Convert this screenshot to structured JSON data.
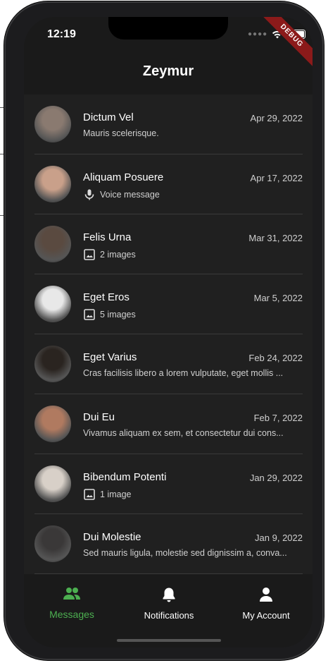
{
  "status": {
    "time": "12:19",
    "debug_banner": "DEBUG"
  },
  "appbar": {
    "title": "Zeymur"
  },
  "conversations": [
    {
      "name": "Dictum Vel",
      "date": "Apr 29, 2022",
      "preview": "Mauris scelerisque.",
      "type": "text",
      "avatar_color": "#8a7a70"
    },
    {
      "name": "Aliquam Posuere",
      "date": "Apr 17, 2022",
      "preview": "Voice message",
      "type": "voice",
      "avatar_color": "#c9a08a"
    },
    {
      "name": "Felis Urna",
      "date": "Mar 31, 2022",
      "preview": "2 images",
      "type": "image",
      "avatar_color": "#5a4a40"
    },
    {
      "name": "Eget Eros",
      "date": "Mar 5, 2022",
      "preview": "5 images",
      "type": "image",
      "avatar_color": "#e8e8e8"
    },
    {
      "name": "Eget Varius",
      "date": "Feb 24, 2022",
      "preview": "Cras facilisis libero a lorem vulputate, eget mollis ...",
      "type": "text",
      "avatar_color": "#2a2420"
    },
    {
      "name": "Dui Eu",
      "date": "Feb 7, 2022",
      "preview": "Vivamus aliquam ex sem, et consectetur dui cons...",
      "type": "text",
      "avatar_color": "#b07a60"
    },
    {
      "name": "Bibendum Potenti",
      "date": "Jan 29, 2022",
      "preview": "1 image",
      "type": "image",
      "avatar_color": "#d8d0c8"
    },
    {
      "name": "Dui Molestie",
      "date": "Jan 9, 2022",
      "preview": "Sed mauris ligula, molestie sed dignissim a, conva...",
      "type": "text",
      "avatar_color": "#3a3838"
    }
  ],
  "tabs": [
    {
      "label": "Messages",
      "icon": "people-icon",
      "active": true
    },
    {
      "label": "Notifications",
      "icon": "bell-icon",
      "active": false
    },
    {
      "label": "My Account",
      "icon": "person-icon",
      "active": false
    }
  ],
  "colors": {
    "accent": "#4caf50",
    "background": "#202020",
    "appbar": "#1a1a1a"
  }
}
